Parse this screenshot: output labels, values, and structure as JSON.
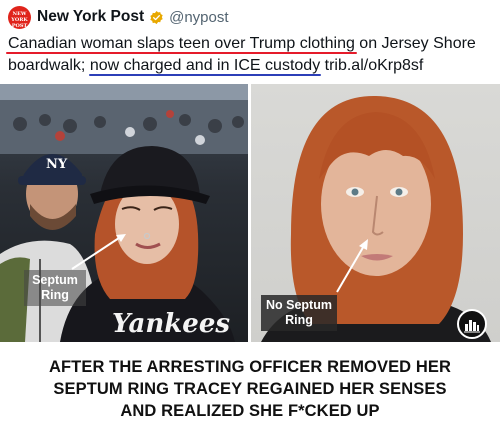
{
  "tweet": {
    "avatar_text": "NEW YORK POST",
    "author_name": "New York Post",
    "handle": "@nypost",
    "text_line1_underlined": "Canadian woman slaps teen over Trump clothing",
    "text_line1_rest": " on Jersey Shore",
    "text_line2_start": "boardwalk; ",
    "text_line2_underlined": "now charged and in ICE custody",
    "text_line2_link": " trib.al/oKrp8sf"
  },
  "photos": {
    "left_label": "Septum Ring",
    "right_label": "No Septum Ring",
    "jersey_text": "Yankees"
  },
  "caption": {
    "line1": "AFTER THE ARRESTING OFFICER REMOVED HER",
    "line2": "SEPTUM RING TRACEY REGAINED HER SENSES",
    "line3": "AND REALIZED SHE F*CKED UP"
  },
  "colors": {
    "brand_red": "#e0241b",
    "verified_gold": "#e8a800",
    "underline_red": "#e51b2a",
    "underline_blue": "#2c3fb8"
  }
}
